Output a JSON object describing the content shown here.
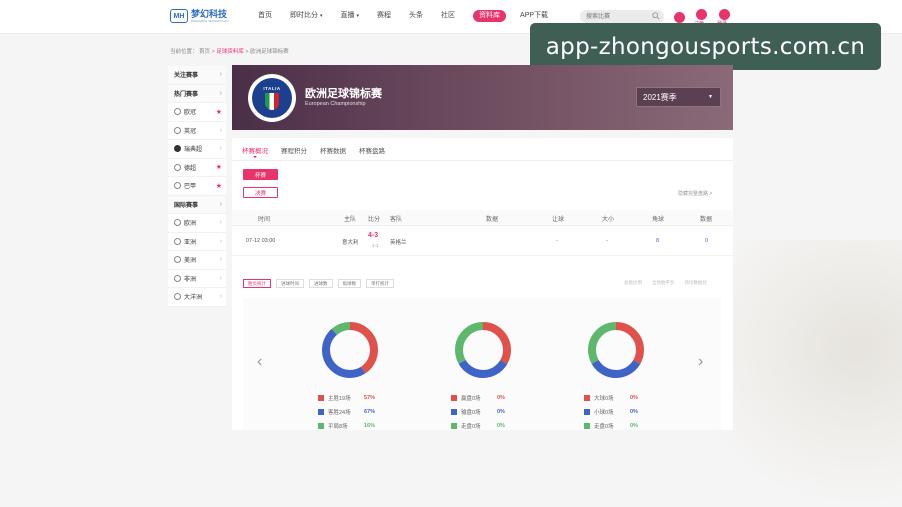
{
  "header": {
    "logo_cn": "梦幻科技",
    "logo_en": "DREAMING TECHNOLOGY",
    "logo_mark": "MH",
    "nav": [
      {
        "label": "首页",
        "dropdown": false,
        "active": false
      },
      {
        "label": "即时比分",
        "dropdown": true,
        "active": false
      },
      {
        "label": "直播",
        "dropdown": true,
        "active": false
      },
      {
        "label": "赛程",
        "dropdown": false,
        "active": false
      },
      {
        "label": "头条",
        "dropdown": false,
        "active": false
      },
      {
        "label": "社区",
        "dropdown": false,
        "active": false
      },
      {
        "label": "资料库",
        "dropdown": false,
        "active": true
      },
      {
        "label": "APP下载",
        "dropdown": false,
        "active": false
      }
    ],
    "search_placeholder": "搜索比赛",
    "icon_labels": [
      "",
      "注册",
      "登录"
    ],
    "accent_color": "#e8336b"
  },
  "watermark": "app-zhongousports.com.cn",
  "breadcrumb": {
    "prefix": "当前位置：",
    "home": "首页",
    "section": "足球资料库",
    "current": "欧洲足球锦标赛",
    "sep": " > "
  },
  "sidebar": [
    {
      "label": "关注赛事",
      "type": "group",
      "icon": "",
      "star": false
    },
    {
      "label": "热门赛事",
      "type": "group",
      "icon": "",
      "star": false
    },
    {
      "label": "欧冠",
      "type": "item",
      "icon": "football-icon",
      "star": true
    },
    {
      "label": "英冠",
      "type": "item",
      "icon": "trophy-icon",
      "star": false
    },
    {
      "label": "瑞典超",
      "type": "item",
      "icon": "league-icon",
      "star": false
    },
    {
      "label": "德超",
      "type": "item",
      "icon": "football-icon",
      "star": true
    },
    {
      "label": "巴甲",
      "type": "item",
      "icon": "football-icon",
      "star": true
    },
    {
      "label": "国际赛事",
      "type": "group",
      "icon": "",
      "star": false
    },
    {
      "label": "欧洲",
      "type": "item",
      "icon": "globe-icon",
      "star": false
    },
    {
      "label": "亚洲",
      "type": "item",
      "icon": "globe-icon",
      "star": false
    },
    {
      "label": "美洲",
      "type": "item",
      "icon": "globe-icon",
      "star": false
    },
    {
      "label": "非洲",
      "type": "item",
      "icon": "globe-icon",
      "star": false
    },
    {
      "label": "大洋洲",
      "type": "item",
      "icon": "globe-icon",
      "star": false
    }
  ],
  "hero": {
    "crest_word": "ITALIA",
    "title": "欧洲足球锦标赛",
    "subtitle": "European Championship",
    "season": "2021赛季"
  },
  "tabs": [
    {
      "label": "杯赛概况",
      "active": true
    },
    {
      "label": "赛程积分",
      "active": false
    },
    {
      "label": "杯赛数据",
      "active": false
    },
    {
      "label": "杯赛盘路",
      "active": false
    }
  ],
  "stages": [
    "杯赛",
    "决赛"
  ],
  "hide_link": "隐藏完整盘路 >",
  "table": {
    "headers": [
      "时间",
      "主队",
      "比分",
      "客队",
      "数据",
      "让球",
      "大小",
      "角球",
      "数据"
    ],
    "rows": [
      {
        "time": "07-12 03:00",
        "home": "意大利",
        "score": "4-3",
        "ht": "1-1",
        "away": "英格兰",
        "data": "",
        "handicap": "-",
        "total": "-",
        "corners": "8",
        "stats": "0"
      }
    ]
  },
  "filters": [
    {
      "label": "胜负统计",
      "active": true
    },
    {
      "label": "进球时间",
      "active": false
    },
    {
      "label": "进球数",
      "active": false
    },
    {
      "label": "角球数",
      "active": false
    },
    {
      "label": "单打统计",
      "active": false
    }
  ],
  "right_links": [
    "总盘比例",
    "全场胜平负",
    "场均数据比"
  ],
  "stats": [
    {
      "legend": [
        {
          "label": "主胜19场",
          "pct": "57%",
          "color": "#e0514c",
          "value": 57
        },
        {
          "label": "客胜24场",
          "pct": "67%",
          "color": "#4063c8",
          "value": 67
        },
        {
          "label": "平局8场",
          "pct": "16%",
          "color": "#5db86e",
          "value": 16
        }
      ]
    },
    {
      "legend": [
        {
          "label": "赢盘0场",
          "pct": "0%",
          "color": "#e0514c",
          "value": 0
        },
        {
          "label": "输盘0场",
          "pct": "0%",
          "color": "#4063c8",
          "value": 0
        },
        {
          "label": "走盘0场",
          "pct": "0%",
          "color": "#5db86e",
          "value": 0
        }
      ]
    },
    {
      "legend": [
        {
          "label": "大球0场",
          "pct": "0%",
          "color": "#e0514c",
          "value": 0
        },
        {
          "label": "小球0场",
          "pct": "0%",
          "color": "#4063c8",
          "value": 0
        },
        {
          "label": "走盘0场",
          "pct": "0%",
          "color": "#5db86e",
          "value": 0
        }
      ]
    }
  ]
}
